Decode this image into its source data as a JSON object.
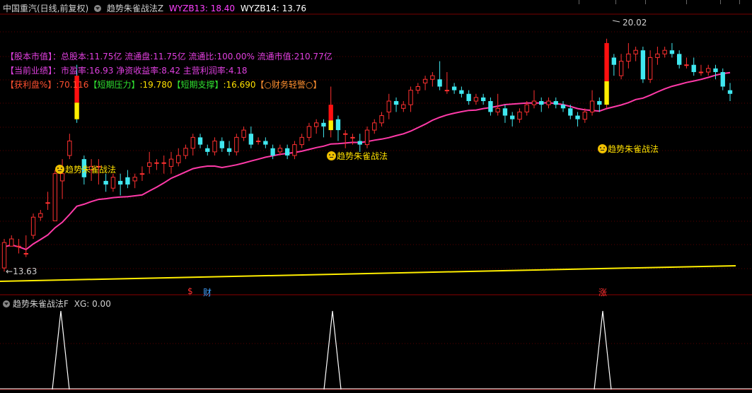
{
  "header": {
    "stock": "中国重汽(日线,前复权)",
    "indicator": "趋势朱雀战法Z",
    "wyzb13_label": "WYZB13: 18.40",
    "wyzb14_label": "WYZB14: 13.76",
    "colors": {
      "wyzb13": "#ff40ff",
      "wyzb14": "#ffffff"
    }
  },
  "info": {
    "line1": "【股本市值】：总股本:11.75亿 流通盘:11.75亿 流通比:100.00% 流通市值:210.77亿",
    "line2": "【当前业绩】：市盈率:16.93 净资收益率:8.42 主营利润率:4.18",
    "line3_a": "【获利盘%】:70.116",
    "line3_b": "【短期压力】",
    "line3_c": ":19.780",
    "line3_d": "【短期支撑】",
    "line3_e": ":16.690",
    "line3_f": "【○财务轻警○】"
  },
  "price_labels": {
    "high": "20.02",
    "low": "13.63"
  },
  "signals": [
    {
      "label": "趋势朱雀战法"
    },
    {
      "label": "趋势朱雀战法"
    },
    {
      "label": "趋势朱雀战法"
    }
  ],
  "markers": {
    "s": "$",
    "cai": "财",
    "zhang": "涨"
  },
  "sub_panel": {
    "title": "趋势朱雀战法F",
    "xg_label": "XG: 0.00"
  },
  "chart_data": {
    "type": "candlestick",
    "ylim": [
      13.0,
      20.6
    ],
    "candles": [
      [
        13.7,
        14.4,
        14.5,
        13.6
      ],
      [
        14.3,
        14.5,
        14.6,
        14.3
      ],
      [
        14.3,
        14.3,
        14.5,
        14.1
      ],
      [
        14.1,
        14.1,
        14.6,
        14.0
      ],
      [
        14.6,
        15.1,
        15.2,
        14.5
      ],
      [
        15.1,
        15.2,
        15.3,
        15.0
      ],
      [
        15.5,
        15.5,
        15.8,
        15.3
      ],
      [
        15.0,
        16.3,
        16.4,
        15.0
      ],
      [
        16.1,
        16.3,
        16.7,
        15.6
      ],
      [
        16.8,
        17.2,
        17.4,
        16.7
      ],
      [
        19.0,
        17.8,
        19.3,
        17.7
      ],
      [
        16.7,
        16.2,
        16.8,
        16.0
      ],
      [
        16.4,
        16.5,
        16.7,
        16.1
      ],
      [
        16.5,
        16.5,
        16.7,
        16.0
      ],
      [
        16.1,
        16.0,
        16.3,
        15.8
      ],
      [
        15.9,
        16.2,
        16.3,
        15.8
      ],
      [
        16.1,
        16.0,
        16.3,
        15.7
      ],
      [
        16.2,
        16.0,
        16.4,
        15.9
      ],
      [
        16.1,
        16.2,
        16.3,
        15.9
      ],
      [
        16.3,
        16.3,
        16.5,
        16.1
      ],
      [
        16.5,
        16.6,
        16.9,
        16.3
      ],
      [
        16.6,
        16.6,
        16.7,
        16.4
      ],
      [
        16.6,
        16.6,
        16.8,
        16.3
      ],
      [
        16.5,
        16.7,
        16.9,
        16.3
      ],
      [
        16.6,
        16.8,
        17.0,
        16.5
      ],
      [
        16.8,
        17.0,
        17.1,
        16.7
      ],
      [
        17.0,
        17.3,
        17.4,
        16.8
      ],
      [
        17.3,
        17.1,
        17.4,
        17.0
      ],
      [
        17.0,
        16.9,
        17.1,
        16.8
      ],
      [
        16.9,
        17.2,
        17.3,
        16.8
      ],
      [
        17.2,
        17.0,
        17.3,
        16.9
      ],
      [
        17.0,
        16.9,
        17.2,
        16.8
      ],
      [
        16.9,
        17.3,
        17.4,
        16.8
      ],
      [
        17.3,
        17.5,
        17.6,
        17.2
      ],
      [
        17.4,
        17.1,
        17.6,
        17.0
      ],
      [
        17.2,
        17.2,
        17.3,
        17.1
      ],
      [
        17.2,
        17.1,
        17.3,
        17.0
      ],
      [
        17.0,
        16.8,
        17.1,
        16.7
      ],
      [
        16.9,
        17.0,
        17.1,
        16.8
      ],
      [
        17.0,
        16.8,
        17.1,
        16.7
      ],
      [
        16.8,
        17.1,
        17.2,
        16.7
      ],
      [
        17.1,
        17.3,
        17.4,
        17.0
      ],
      [
        17.3,
        17.6,
        17.7,
        17.2
      ],
      [
        17.6,
        17.7,
        17.8,
        17.4
      ],
      [
        17.7,
        17.6,
        17.8,
        17.3
      ],
      [
        17.5,
        18.2,
        18.7,
        17.3
      ],
      [
        17.8,
        17.5,
        17.9,
        17.2
      ],
      [
        17.4,
        17.4,
        17.5,
        17.0
      ],
      [
        17.3,
        17.3,
        17.4,
        17.1
      ],
      [
        17.2,
        17.1,
        17.4,
        16.9
      ],
      [
        17.1,
        17.5,
        17.6,
        17.0
      ],
      [
        17.5,
        17.7,
        17.8,
        17.4
      ],
      [
        17.7,
        17.9,
        18.0,
        17.6
      ],
      [
        18.0,
        18.3,
        18.5,
        17.8
      ],
      [
        18.3,
        18.2,
        18.4,
        18.0
      ],
      [
        18.1,
        18.2,
        18.3,
        18.0
      ],
      [
        18.2,
        18.6,
        18.7,
        18.0
      ],
      [
        18.6,
        18.7,
        18.8,
        18.5
      ],
      [
        18.8,
        18.9,
        19.0,
        18.6
      ],
      [
        18.9,
        19.0,
        19.1,
        18.7
      ],
      [
        18.9,
        18.7,
        19.4,
        18.6
      ],
      [
        18.6,
        18.6,
        19.1,
        18.5
      ],
      [
        18.7,
        18.6,
        18.8,
        18.5
      ],
      [
        18.6,
        18.5,
        18.7,
        18.4
      ],
      [
        18.5,
        18.3,
        18.6,
        18.2
      ],
      [
        18.3,
        18.4,
        18.5,
        18.2
      ],
      [
        18.4,
        18.3,
        18.5,
        18.2
      ],
      [
        18.3,
        18.0,
        18.4,
        17.9
      ],
      [
        18.0,
        18.1,
        18.5,
        17.9
      ],
      [
        18.1,
        17.9,
        18.2,
        17.7
      ],
      [
        17.9,
        17.8,
        18.0,
        17.6
      ],
      [
        17.8,
        18.0,
        18.1,
        17.7
      ],
      [
        18.0,
        18.2,
        18.3,
        17.9
      ],
      [
        18.2,
        18.3,
        18.6,
        18.1
      ],
      [
        18.3,
        18.2,
        18.4,
        18.0
      ],
      [
        18.2,
        18.3,
        18.4,
        18.1
      ],
      [
        18.3,
        18.2,
        18.4,
        18.1
      ],
      [
        18.2,
        18.1,
        18.3,
        18.0
      ],
      [
        18.1,
        17.9,
        18.2,
        17.8
      ],
      [
        17.9,
        17.8,
        18.0,
        17.6
      ],
      [
        17.8,
        18.0,
        18.1,
        17.7
      ],
      [
        18.0,
        18.3,
        18.6,
        17.9
      ],
      [
        18.3,
        18.2,
        18.4,
        18.0
      ],
      [
        18.2,
        19.9,
        20.02,
        18.1
      ],
      [
        19.5,
        19.3,
        19.6,
        19.0
      ],
      [
        19.0,
        19.4,
        19.6,
        18.9
      ],
      [
        19.4,
        19.6,
        19.9,
        19.2
      ],
      [
        19.6,
        19.7,
        19.8,
        19.4
      ],
      [
        19.7,
        18.9,
        19.8,
        18.8
      ],
      [
        18.9,
        19.5,
        19.7,
        18.8
      ],
      [
        19.5,
        19.6,
        19.8,
        19.3
      ],
      [
        19.6,
        19.7,
        19.8,
        19.5
      ],
      [
        19.7,
        19.6,
        19.9,
        19.5
      ],
      [
        19.6,
        19.3,
        19.7,
        19.2
      ],
      [
        19.3,
        19.3,
        19.5,
        19.2
      ],
      [
        19.3,
        19.1,
        19.5,
        19.0
      ],
      [
        19.1,
        19.1,
        19.3,
        19.0
      ],
      [
        19.1,
        19.2,
        19.3,
        19.0
      ],
      [
        19.2,
        19.1,
        19.3,
        18.9
      ],
      [
        19.1,
        18.7,
        19.2,
        18.6
      ],
      [
        18.6,
        18.5,
        18.8,
        18.3
      ]
    ]
  }
}
